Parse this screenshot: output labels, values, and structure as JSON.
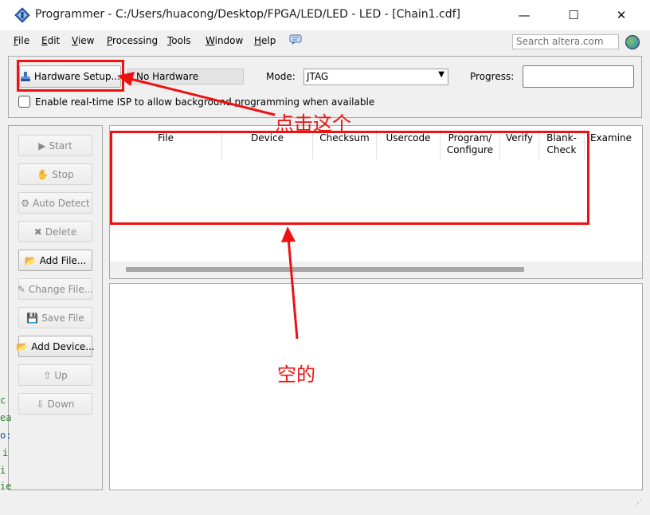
{
  "window": {
    "title": "Programmer - C:/Users/huacong/Desktop/FPGA/LED/LED - LED - [Chain1.cdf]",
    "controls": {
      "minimize": "—",
      "maximize": "☐",
      "close": "✕"
    }
  },
  "menubar": {
    "items": [
      {
        "u": "F",
        "rest": "ile"
      },
      {
        "u": "E",
        "rest": "dit"
      },
      {
        "u": "V",
        "rest": "iew"
      },
      {
        "u": "P",
        "rest": "rocessing"
      },
      {
        "u": "T",
        "rest": "ools"
      },
      {
        "u": "W",
        "rest": "indow"
      },
      {
        "u": "H",
        "rest": "elp"
      }
    ],
    "search_placeholder": "Search altera.com"
  },
  "toolbar": {
    "hardware_setup": "Hardware Setup...",
    "hardware_value": "No Hardware",
    "mode_label": "Mode:",
    "mode_value": "JTAG",
    "progress_label": "Progress:",
    "progress_value": 0,
    "isp_label": "Enable real-time ISP to allow background programming when available",
    "isp_checked": false
  },
  "side_buttons": [
    {
      "label": "Start",
      "icon": "play-icon",
      "enabled": false
    },
    {
      "label": "Stop",
      "icon": "stop-hand-icon",
      "enabled": false
    },
    {
      "label": "Auto Detect",
      "icon": "auto-detect-icon",
      "enabled": false
    },
    {
      "label": "Delete",
      "icon": "delete-x-icon",
      "enabled": false
    },
    {
      "label": "Add File...",
      "icon": "folder-open-icon",
      "enabled": true
    },
    {
      "label": "Change File...",
      "icon": "change-file-icon",
      "enabled": false
    },
    {
      "label": "Save File",
      "icon": "save-disk-icon",
      "enabled": false
    },
    {
      "label": "Add Device...",
      "icon": "add-device-icon",
      "enabled": true
    },
    {
      "label": "Up",
      "icon": "up-arrow-icon",
      "enabled": false
    },
    {
      "label": "Down",
      "icon": "down-arrow-icon",
      "enabled": false
    }
  ],
  "table": {
    "columns": [
      "File",
      "Device",
      "Checksum",
      "Usercode",
      "Program/\nConfigure",
      "Verify",
      "Blank-\nCheck",
      "Examine"
    ],
    "rows": []
  },
  "annotations": {
    "click_this": "点击这个",
    "empty": "空的",
    "color": "#ee1111"
  },
  "background_fragments": [
    "c",
    "ea",
    "o:",
    "i",
    "i",
    "ie"
  ],
  "colors": {
    "accent": "#ee1111",
    "window_bg": "#f0f0f0"
  }
}
